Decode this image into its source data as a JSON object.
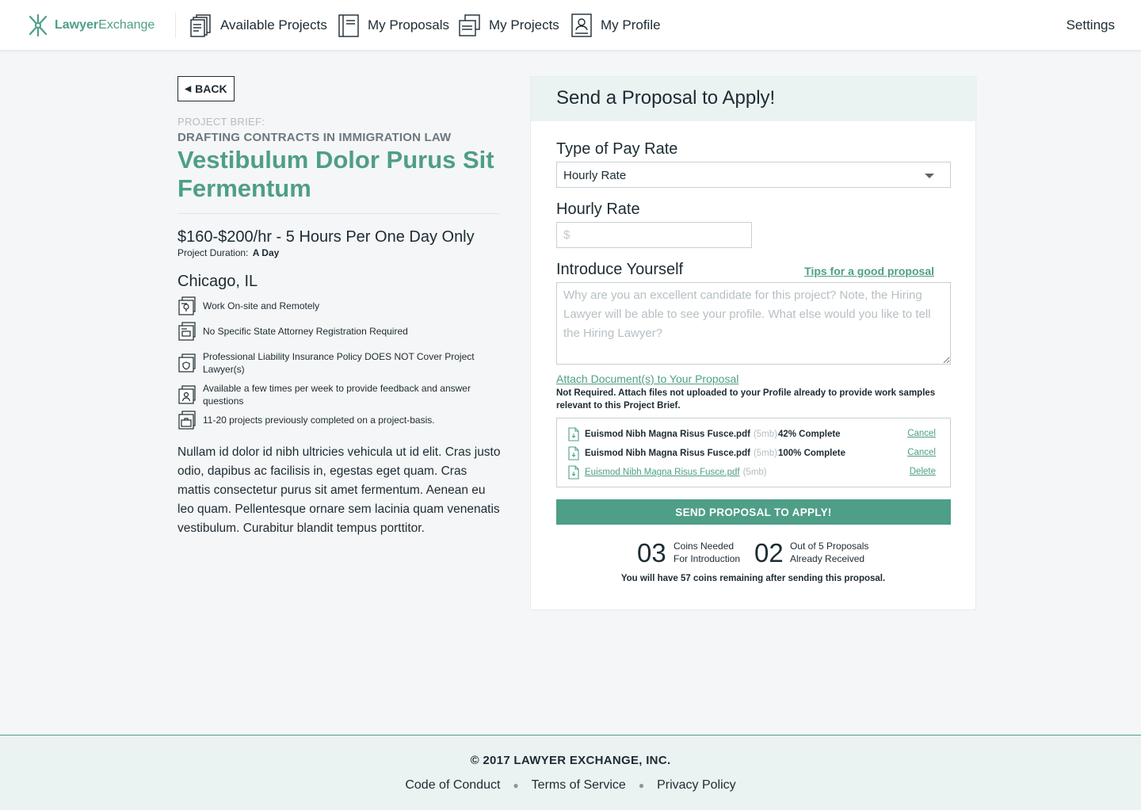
{
  "brand": {
    "name_bold": "Lawyer",
    "name_light": "Exchange",
    "accent": "#4e9e88"
  },
  "nav": {
    "items": [
      {
        "label": "Available Projects",
        "icon": "documents-stack-icon"
      },
      {
        "label": "My Proposals",
        "icon": "notebook-icon"
      },
      {
        "label": "My Projects",
        "icon": "folder-documents-icon"
      },
      {
        "label": "My Profile",
        "icon": "profile-card-icon"
      }
    ],
    "settings": "Settings"
  },
  "brief": {
    "back_label": "BACK",
    "label": "PROJECT BRIEF:",
    "category": "DRAFTING CONTRACTS IN IMMIGRATION LAW",
    "title": "Vestibulum Dolor Purus Sit Fermentum",
    "rate": "$160-$200/hr - 5 Hours Per One Day Only",
    "duration_label": "Project Duration:",
    "duration_value": "A Day",
    "location": "Chicago, IL",
    "features": [
      {
        "text": "Work On-site and Remotely",
        "icon": "location-document-icon"
      },
      {
        "text": "No Specific State Attorney Registration Required",
        "icon": "registration-document-icon"
      },
      {
        "text": "Professional Liability Insurance Policy DOES NOT Cover Project Lawyer(s)",
        "icon": "shield-document-icon"
      },
      {
        "text": "Available a few times per week to provide feedback and answer questions",
        "icon": "person-document-icon"
      },
      {
        "text": "11-20 projects previously completed on a project-basis.",
        "icon": "briefcase-document-icon"
      }
    ],
    "description": "Nullam id dolor id nibh ultricies vehicula ut id elit. Cras justo odio, dapibus ac facilisis in, egestas eget quam. Cras mattis consectetur purus sit amet fermentum. Aenean eu leo quam. Pellentesque ornare sem lacinia quam venenatis vestibulum. Curabitur blandit tempus porttitor."
  },
  "proposal": {
    "heading": "Send a Proposal to Apply!",
    "pay_type_label": "Type of Pay Rate",
    "pay_type_value": "Hourly Rate",
    "hourly_label": "Hourly Rate",
    "hourly_placeholder": "$",
    "hourly_value": "",
    "intro_label": "Introduce Yourself",
    "tips_link": "Tips for a good proposal",
    "intro_placeholder": "Why are you an excellent candidate for this project? Note, the Hiring Lawyer will be able to see your profile. What else would you like to tell the Hiring Lawyer?",
    "attach_link": "Attach Document(s) to Your Proposal",
    "attach_note": "Not Required. Attach files not uploaded to your Profile already to provide work samples relevant to this Project Brief.",
    "files": [
      {
        "name": "Euismod Nibh Magna Risus Fusce.pdf",
        "size": "(5mb)",
        "status": "42% Complete",
        "action": "Cancel"
      },
      {
        "name": "Euismod Nibh Magna Risus Fusce.pdf",
        "size": "(5mb)",
        "status": "100% Complete",
        "action": "Cancel"
      },
      {
        "name": "Euismod Nibh Magna Risus Fusce.pdf",
        "size": "(5mb)",
        "status": "",
        "action": "Delete"
      }
    ],
    "send_label": "SEND PROPOSAL TO APPLY!",
    "coins_num": "03",
    "coins_line1": "Coins Needed",
    "coins_line2": "For Introduction",
    "proposals_num": "02",
    "proposals_line1": "Out of 5 Proposals",
    "proposals_line2": "Already Received",
    "remaining_note": "You will have 57 coins remaining after sending this proposal."
  },
  "footer": {
    "copyright": "© 2017 LAWYER EXCHANGE, INC.",
    "links": [
      "Code of Conduct",
      "Terms of Service",
      "Privacy Policy"
    ]
  }
}
